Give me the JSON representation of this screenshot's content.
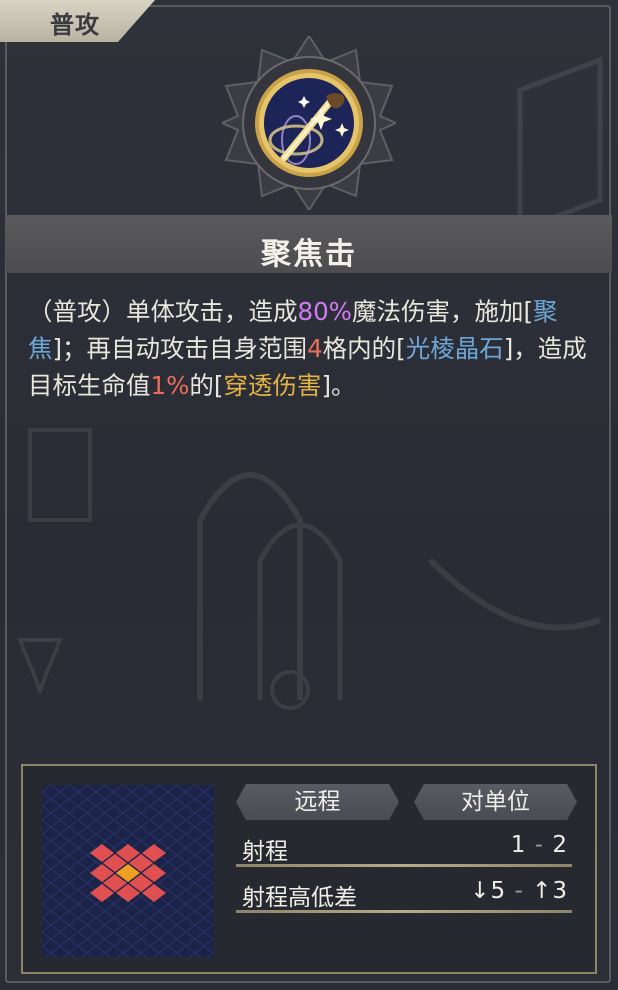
{
  "skill": {
    "type_label": "普攻",
    "name": "聚焦击",
    "icon": "focus-strike-icon",
    "description": {
      "p1": "（普攻）单体攻击，造成",
      "v_percent": "80%",
      "p2": "魔法伤害，施加[",
      "kw_focus": "聚焦",
      "p3": "]；再自动攻击自身范围",
      "v_range": "4",
      "p4": "格内的[",
      "kw_crystal": "光棱晶石",
      "p5": "]，造成目标生命值",
      "v_hp": "1%",
      "p6": "的[",
      "kw_pierce": "穿透伤害",
      "p7": "]。"
    }
  },
  "attack": {
    "mode": "远程",
    "target": "对单位",
    "range_label": "射程",
    "range_min": "1",
    "range_sep": "-",
    "range_max": "2",
    "height_label": "射程高低差",
    "height_down": "↓5",
    "height_sep": "-",
    "height_up": "↑3"
  },
  "colors": {
    "magic_damage": "#cf7bf2",
    "status_keyword": "#6ea7d6",
    "number": "#ea6f5a",
    "pierce_damage": "#e2b245",
    "range_tile": "#e05050",
    "range_center": "#f0a020"
  }
}
